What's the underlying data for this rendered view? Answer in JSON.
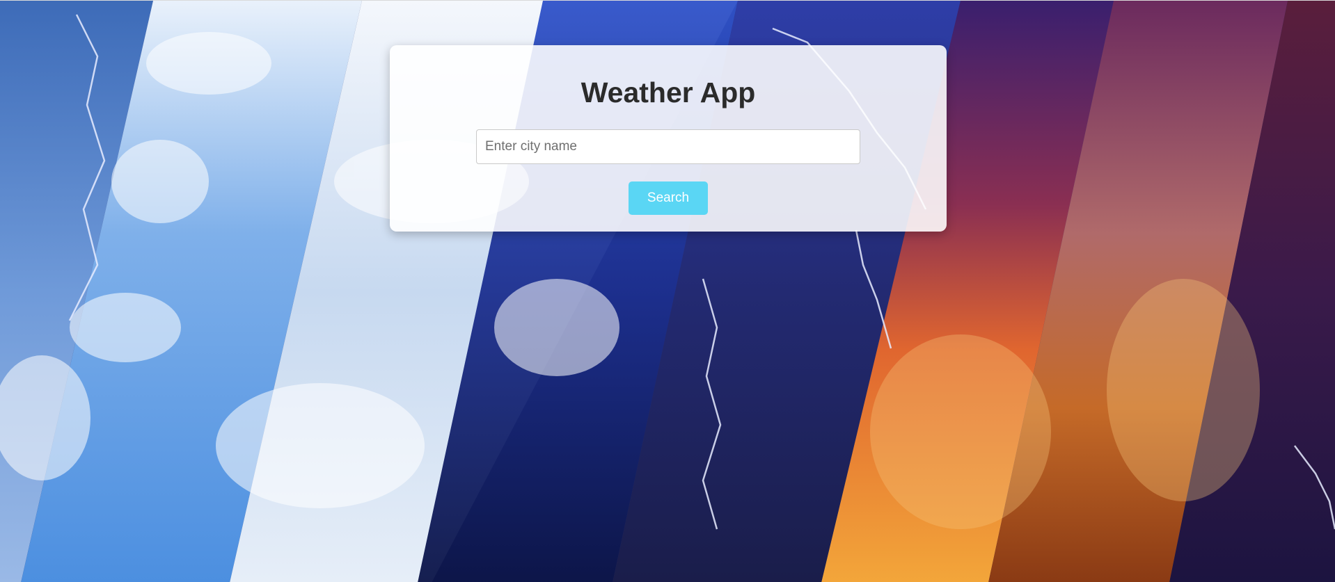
{
  "app": {
    "title": "Weather App"
  },
  "search": {
    "placeholder": "Enter city name",
    "value": "",
    "button_label": "Search"
  },
  "background": {
    "description_icon": "weather-collage-background"
  },
  "colors": {
    "button": "#5ad6f4",
    "title": "#2b2b2b",
    "card": "#ffffff"
  }
}
